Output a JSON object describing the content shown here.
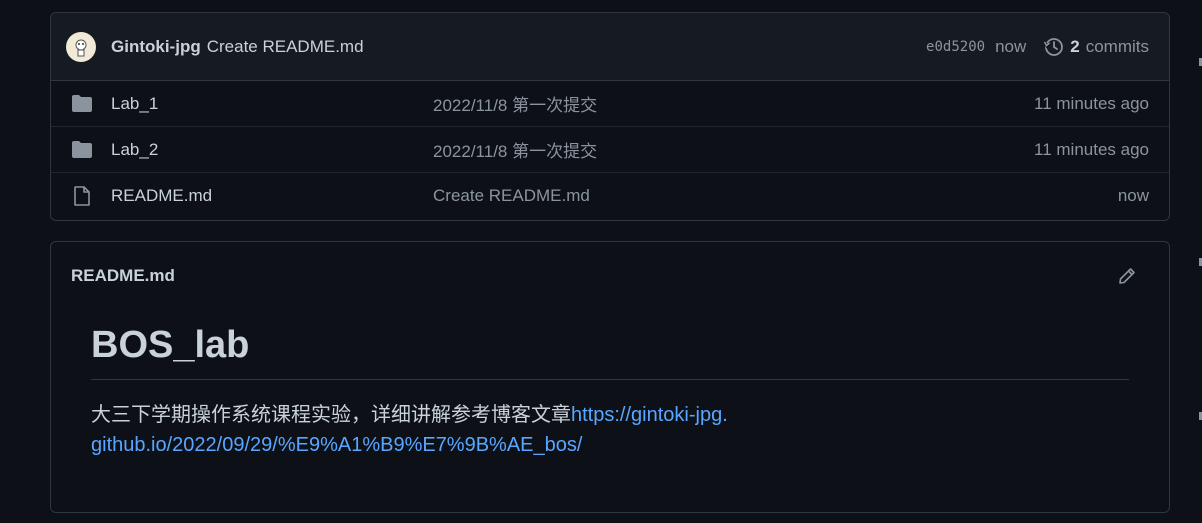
{
  "colors": {
    "background": "#0d1117",
    "header_bg": "#161b22",
    "border": "#30363d",
    "text": "#c9d1d9",
    "muted": "#8b949e",
    "link": "#58a6ff"
  },
  "commit": {
    "author": "Gintoki-jpg",
    "message": "Create README.md",
    "sha": "e0d5200",
    "time": "now",
    "count": "2",
    "count_label": "commits",
    "history_icon": "history-icon"
  },
  "files": [
    {
      "icon": "folder-icon",
      "name": "Lab_1",
      "message": "2022/11/8 第一次提交",
      "time": "11 minutes ago"
    },
    {
      "icon": "folder-icon",
      "name": "Lab_2",
      "message": "2022/11/8 第一次提交",
      "time": "11 minutes ago"
    },
    {
      "icon": "file-icon",
      "name": "README.md",
      "message": "Create README.md",
      "time": "now"
    }
  ],
  "readme": {
    "filename": "README.md",
    "heading": "BOS_lab",
    "text": "大三下学期操作系统课程实验，详细讲解参考博客文章",
    "link": "https://gintoki-jpg.github.io/2022/09/29/%E9%A1%B9%E7%9B%AE_bos/",
    "edit_icon": "pencil-icon"
  }
}
